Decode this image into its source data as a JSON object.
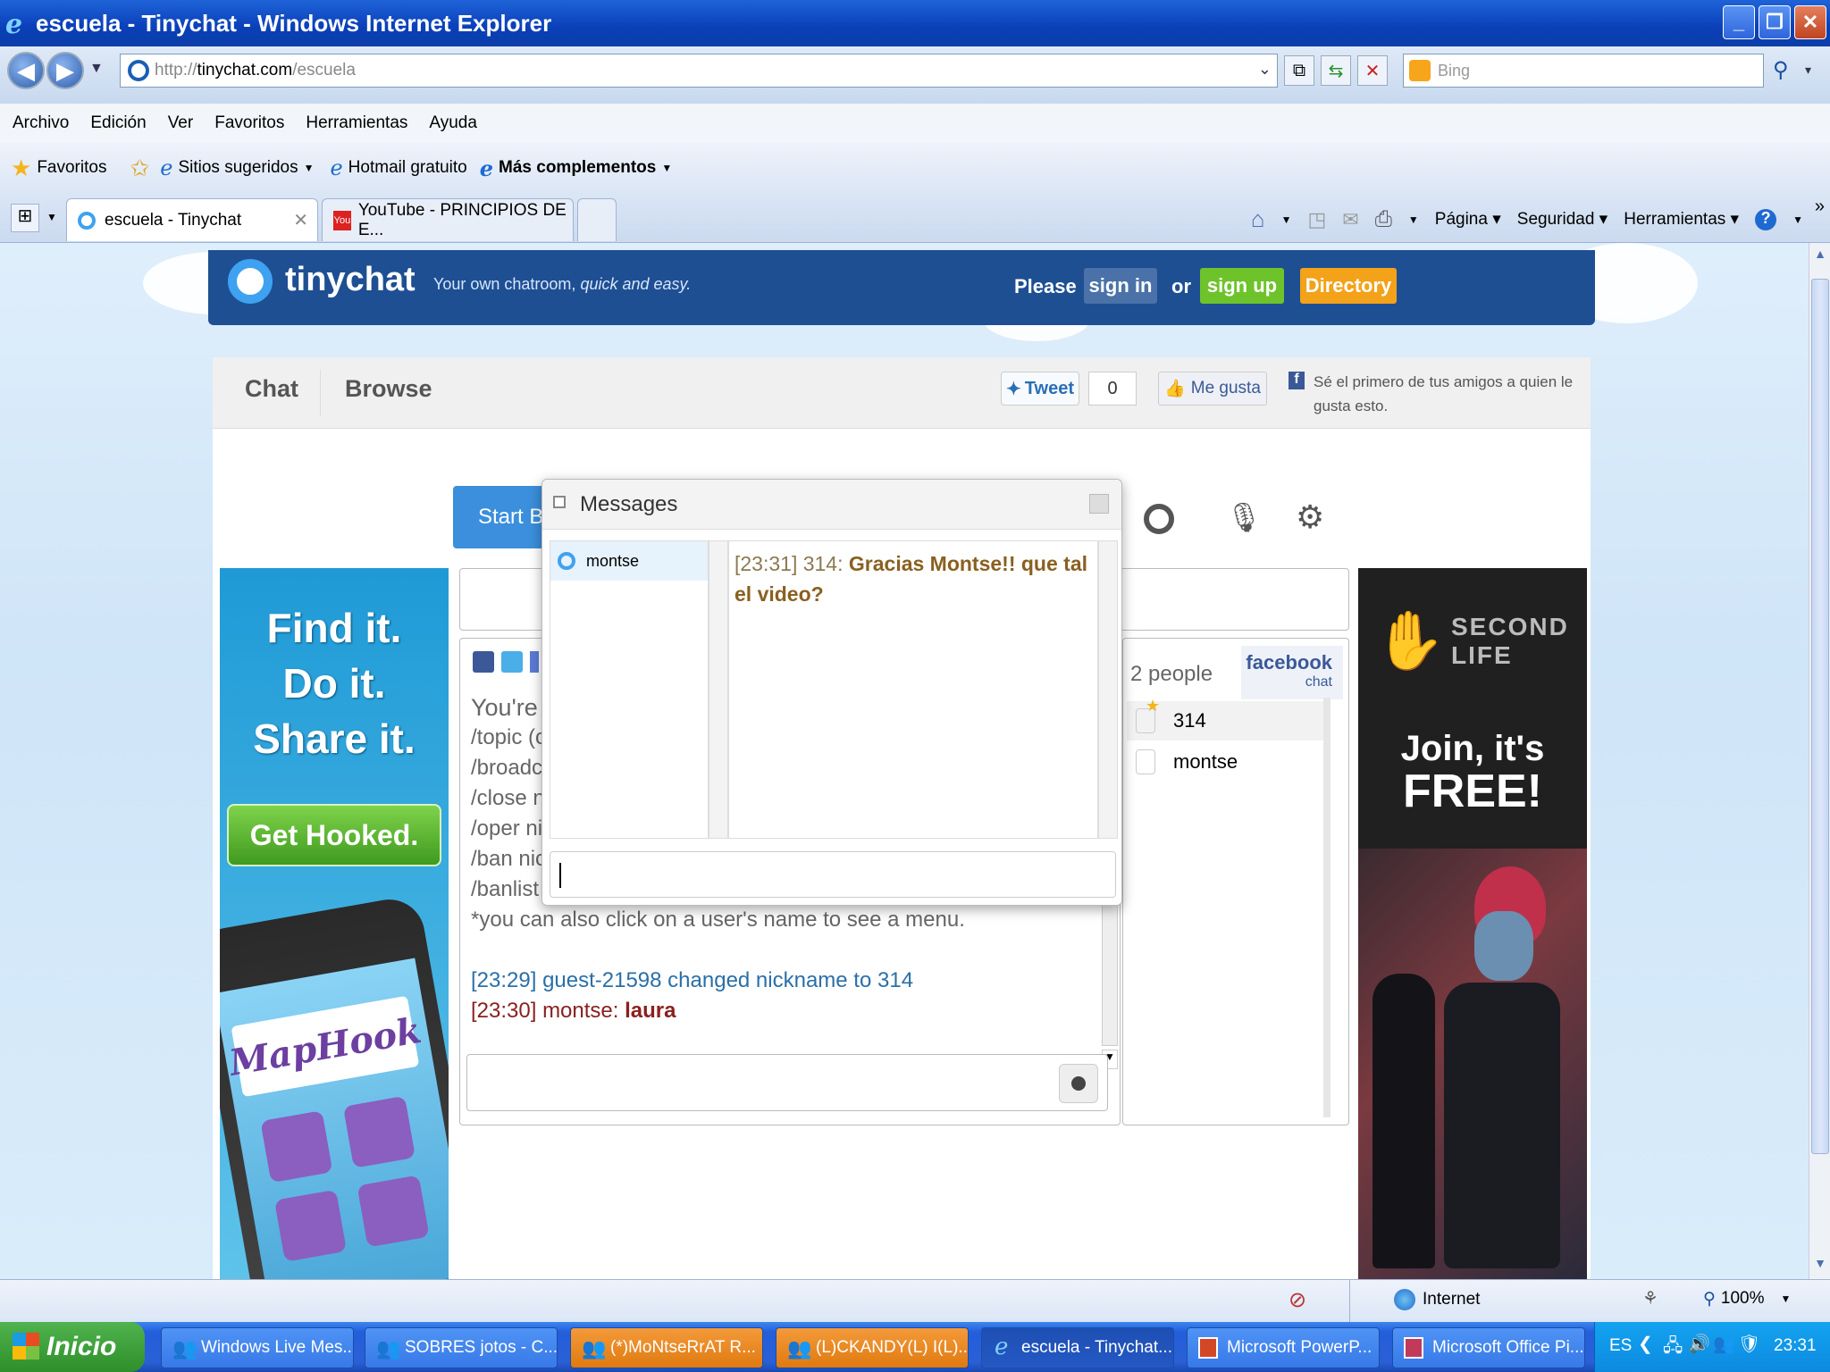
{
  "window": {
    "title": "escuela - Tinychat - Windows Internet Explorer"
  },
  "address": {
    "prefix": "http://",
    "host": "tinychat.com",
    "path": "/escuela",
    "search_placeholder": "Bing"
  },
  "menu": [
    "Archivo",
    "Edición",
    "Ver",
    "Favoritos",
    "Herramientas",
    "Ayuda"
  ],
  "favorites": {
    "label": "Favoritos",
    "items": [
      "Sitios sugeridos",
      "Hotmail gratuito",
      "Más complementos"
    ]
  },
  "tabs": [
    {
      "label": "escuela - Tinychat"
    },
    {
      "label": "YouTube - PRINCIPIOS DE E..."
    }
  ],
  "commandbar": [
    "Página",
    "Seguridad",
    "Herramientas"
  ],
  "tinychat": {
    "logo": "tinychat",
    "tagline_plain": "Your own chatroom,",
    "tagline_italic": "quick and easy.",
    "please": "Please",
    "sign_in": "sign in",
    "or": "or",
    "sign_up": "sign up",
    "directory": "Directory",
    "tab_chat": "Chat",
    "tab_browse": "Browse",
    "tweet": "Tweet",
    "tweet_count": "0",
    "like": "Me gusta",
    "like_text_1": "Sé el primero de tus amigos a quien le",
    "like_text_2": "gusta esto.",
    "start_btn": "Start B",
    "people_count": "2 people",
    "facebook": "facebook",
    "facebook_sub": "chat",
    "users": [
      "314",
      "montse"
    ],
    "help_lines": [
      "You're t",
      "/topic (c",
      "/broadca",
      "/close ni",
      "/oper nic",
      "/ban nick",
      "/banlist ("
    ],
    "help_note": "*you can also click on a user's name to see a menu.",
    "log": [
      {
        "text": "[23:29] guest-21598 changed nickname to 314"
      },
      {
        "prefix": "[23:30] montse: ",
        "bold": "laura"
      }
    ]
  },
  "messages_popup": {
    "title": "Messages",
    "contact": "montse",
    "msg_prefix": "[23:31] 314: ",
    "msg_bold": "Gracias Montse!! que tal el video?"
  },
  "ad_left": {
    "line1": "Find it.",
    "line2": "Do it.",
    "line3": "Share it.",
    "button": "Get Hooked.",
    "app": "MapHook"
  },
  "ad_right": {
    "brand": "SECOND LIFE",
    "line1": "Join, it's",
    "line2": "FREE!"
  },
  "status": {
    "zone": "Internet",
    "zoom": "100%"
  },
  "taskbar": {
    "start": "Inicio",
    "items": [
      "Windows Live Mes...",
      "SOBRES jotos - C...",
      "(*)MoNtseRrAT R...",
      "(L)CKANDY(L) I(L)...",
      "escuela - Tinychat...",
      "Microsoft PowerP...",
      "Microsoft Office Pi..."
    ],
    "lang": "ES",
    "clock": "23:31"
  }
}
